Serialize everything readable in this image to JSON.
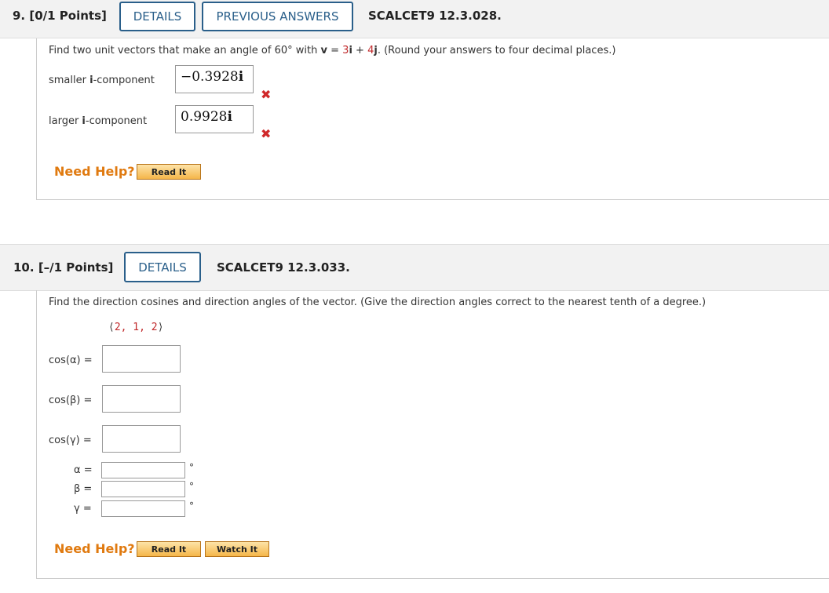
{
  "q9": {
    "number": "9.",
    "points": "[0/1 Points]",
    "details_label": "DETAILS",
    "previous_answers_label": "PREVIOUS ANSWERS",
    "reference": "SCALCET9 12.3.028.",
    "prompt_before": "Find two unit vectors that make an angle of 60° with ",
    "vector_v": "v",
    "equals": " = ",
    "coef_i": "3",
    "i_unit": "i",
    "plus": " + ",
    "coef_j": "4",
    "j_unit": "j",
    "prompt_after": ". (Round your answers to four decimal places.)",
    "smaller_label_pre": "smaller ",
    "smaller_label_bold": "i",
    "smaller_label_post": "-component",
    "smaller_value": "−0.3928",
    "larger_label_pre": "larger ",
    "larger_label_bold": "i",
    "larger_label_post": "-component",
    "larger_value": "0.9928",
    "unit_suffix": "i",
    "incorrect_mark": "✖",
    "need_help": "Need Help?",
    "read_it": "Read It"
  },
  "q10": {
    "number": "10.",
    "points": "[–/1 Points]",
    "details_label": "DETAILS",
    "reference": "SCALCET9 12.3.033.",
    "prompt": "Find the direction cosines and direction angles of the vector. (Give the direction angles correct to the nearest tenth of a degree.)",
    "vector_open": "⟨",
    "vector_components": "2, 1, 2",
    "vector_close": "⟩",
    "cos_alpha_label": "cos(α) =",
    "cos_beta_label": "cos(β) =",
    "cos_gamma_label": "cos(γ) =",
    "alpha_label": "α =",
    "beta_label": "β =",
    "gamma_label": "γ =",
    "degree_symbol": "°",
    "need_help": "Need Help?",
    "read_it": "Read It",
    "watch_it": "Watch It"
  }
}
